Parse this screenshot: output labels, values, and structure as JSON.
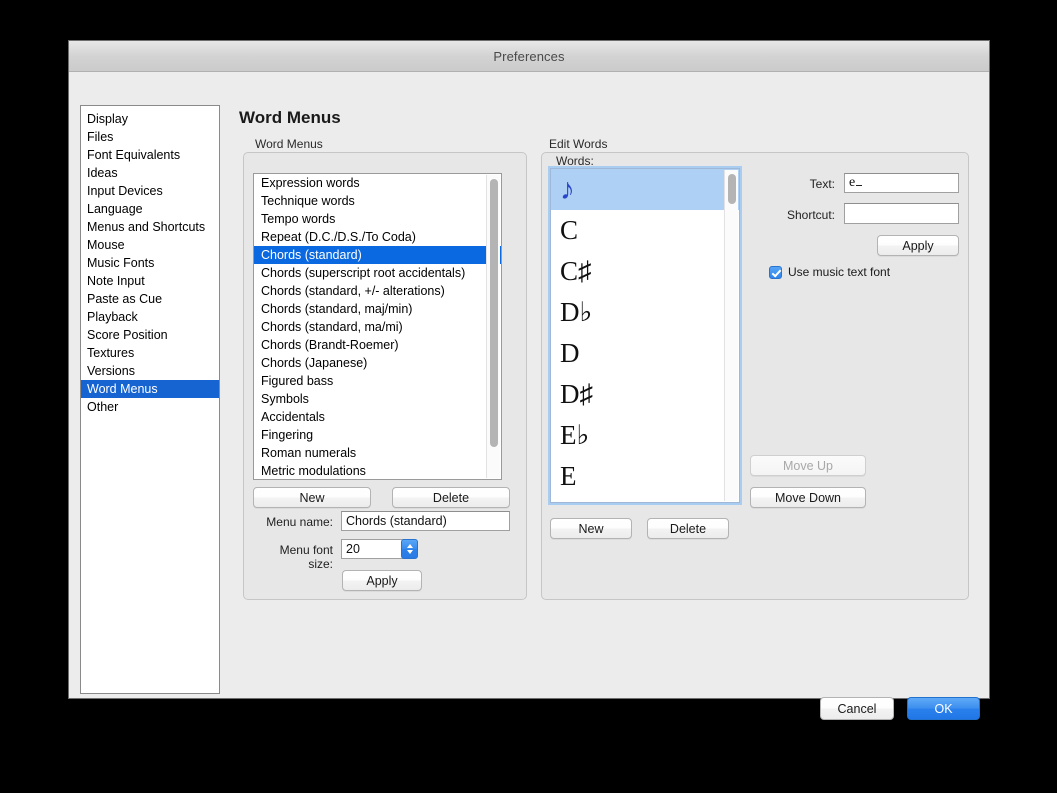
{
  "window": {
    "title": "Preferences"
  },
  "sidebar": {
    "items": [
      {
        "label": "Display",
        "selected": false
      },
      {
        "label": "Files",
        "selected": false
      },
      {
        "label": "Font Equivalents",
        "selected": false
      },
      {
        "label": "Ideas",
        "selected": false
      },
      {
        "label": "Input Devices",
        "selected": false
      },
      {
        "label": "Language",
        "selected": false
      },
      {
        "label": "Menus and Shortcuts",
        "selected": false
      },
      {
        "label": "Mouse",
        "selected": false
      },
      {
        "label": "Music Fonts",
        "selected": false
      },
      {
        "label": "Note Input",
        "selected": false
      },
      {
        "label": "Paste as Cue",
        "selected": false
      },
      {
        "label": "Playback",
        "selected": false
      },
      {
        "label": "Score Position",
        "selected": false
      },
      {
        "label": "Textures",
        "selected": false
      },
      {
        "label": "Versions",
        "selected": false
      },
      {
        "label": "Word Menus",
        "selected": true
      },
      {
        "label": "Other",
        "selected": false
      }
    ]
  },
  "page": {
    "title": "Word Menus"
  },
  "word_menus_group": {
    "label": "Word Menus",
    "list_items": [
      {
        "label": "Expression words",
        "selected": false
      },
      {
        "label": "Technique words",
        "selected": false
      },
      {
        "label": "Tempo words",
        "selected": false
      },
      {
        "label": "Repeat (D.C./D.S./To Coda)",
        "selected": false
      },
      {
        "label": "Chords (standard)",
        "selected": true
      },
      {
        "label": "Chords (superscript root accidentals)",
        "selected": false
      },
      {
        "label": "Chords (standard, +/- alterations)",
        "selected": false
      },
      {
        "label": "Chords (standard, maj/min)",
        "selected": false
      },
      {
        "label": "Chords (standard, ma/mi)",
        "selected": false
      },
      {
        "label": "Chords (Brandt-Roemer)",
        "selected": false
      },
      {
        "label": "Chords (Japanese)",
        "selected": false
      },
      {
        "label": "Figured bass",
        "selected": false
      },
      {
        "label": "Symbols",
        "selected": false
      },
      {
        "label": "Accidentals",
        "selected": false
      },
      {
        "label": "Fingering",
        "selected": false
      },
      {
        "label": "Roman numerals",
        "selected": false
      },
      {
        "label": "Metric modulations",
        "selected": false
      }
    ],
    "new_label": "New",
    "delete_label": "Delete",
    "menu_name_label": "Menu name:",
    "menu_name_value": "Chords (standard)",
    "menu_font_size_label": "Menu font size:",
    "menu_font_size_value": "20",
    "apply_label": "Apply"
  },
  "edit_words_group": {
    "label": "Edit Words",
    "words_label": "Words:",
    "words": [
      {
        "label": "♪",
        "selected": true,
        "is_glyph": true
      },
      {
        "label": "C",
        "selected": false,
        "is_glyph": false
      },
      {
        "label": "C♯",
        "selected": false,
        "is_glyph": false
      },
      {
        "label": "D♭",
        "selected": false,
        "is_glyph": false
      },
      {
        "label": "D",
        "selected": false,
        "is_glyph": false
      },
      {
        "label": "D♯",
        "selected": false,
        "is_glyph": false
      },
      {
        "label": "E♭",
        "selected": false,
        "is_glyph": false
      },
      {
        "label": "E",
        "selected": false,
        "is_glyph": false
      }
    ],
    "new_label": "New",
    "delete_label": "Delete",
    "text_label": "Text:",
    "text_value": "e",
    "shortcut_label": "Shortcut:",
    "shortcut_value": "",
    "apply_label": "Apply",
    "use_music_text_font_label": "Use music text font",
    "use_music_text_font_checked": true,
    "move_up_label": "Move Up",
    "move_up_enabled": false,
    "move_down_label": "Move Down",
    "move_down_enabled": true
  },
  "footer": {
    "cancel_label": "Cancel",
    "ok_label": "OK"
  },
  "colors": {
    "selection_blue": "#0a68e0",
    "sidebar_selection_blue": "#1564d2",
    "accent_blue": "#2a80ec",
    "words_selection_blue": "#aed0f5",
    "window_bg": "#ececec",
    "panel_bg": "#e7e7e7"
  }
}
